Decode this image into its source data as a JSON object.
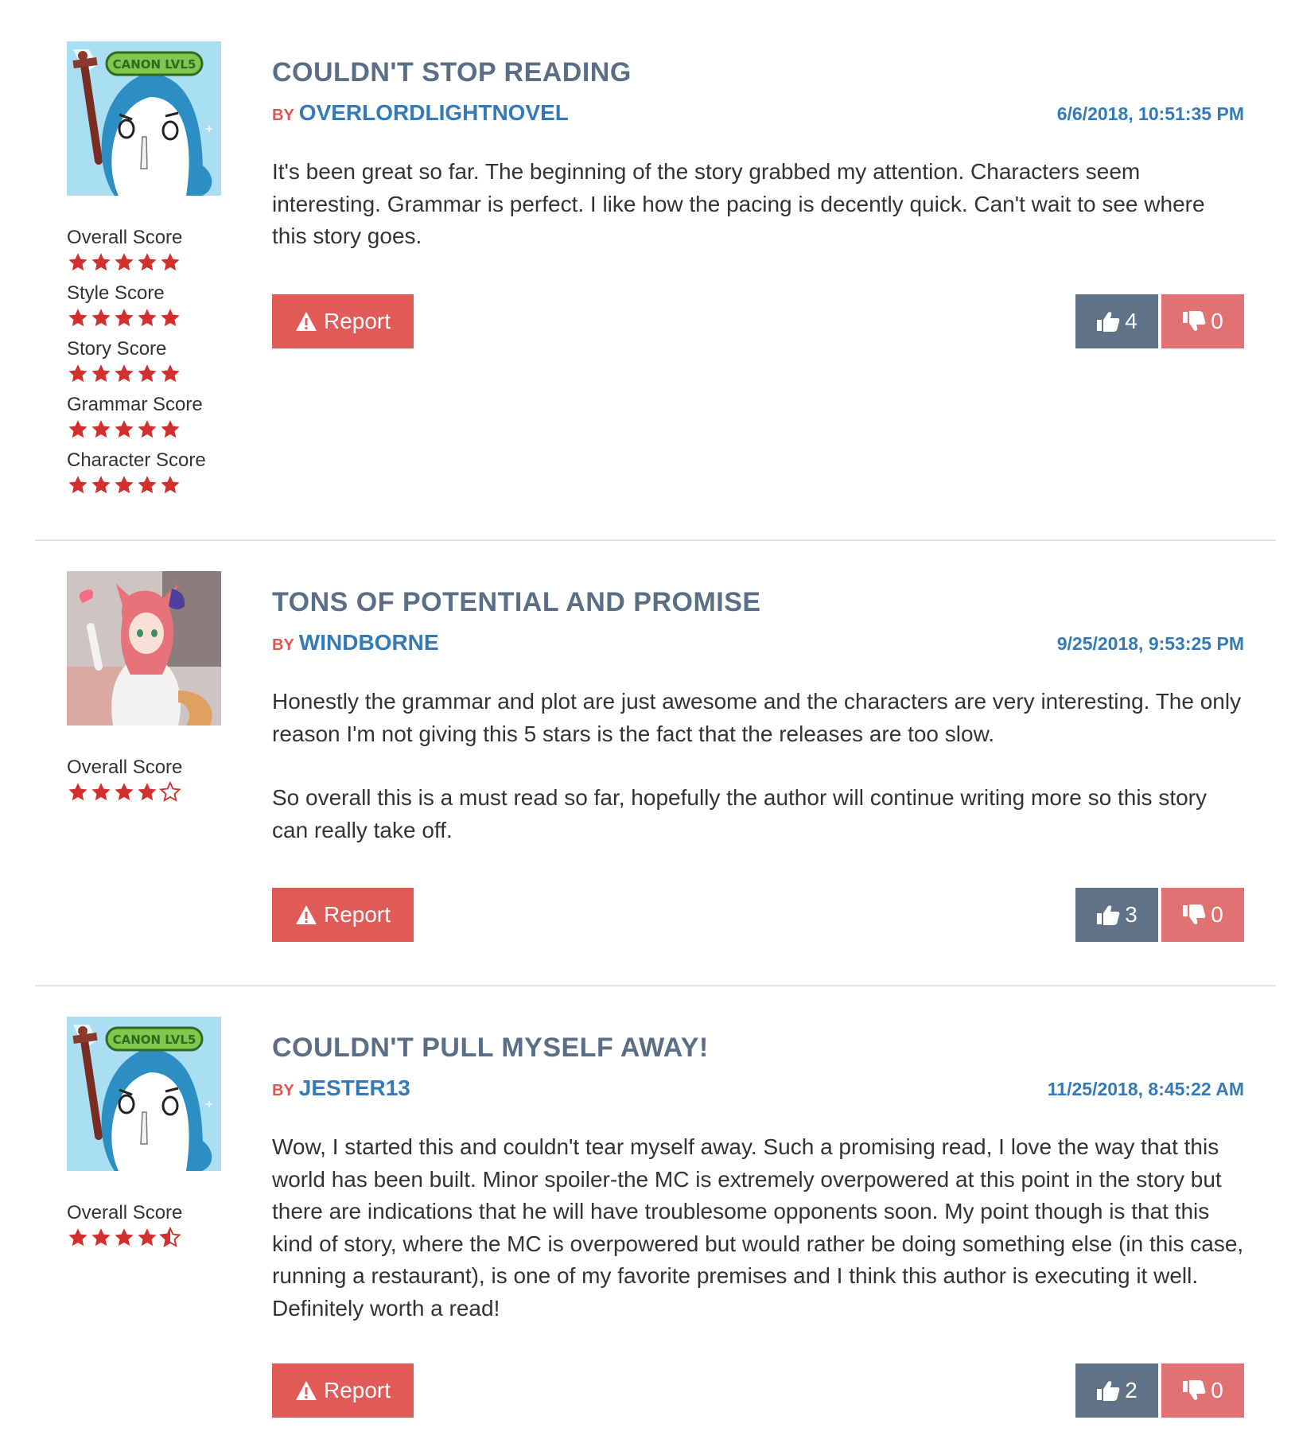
{
  "colors": {
    "title": "#5a6e86",
    "by_label": "#e1534f",
    "author": "#337ab7",
    "date": "#337ab7",
    "star": "#d32f2f",
    "report_bg": "#e05a58",
    "upvote_bg": "#5f7287",
    "downvote_bg": "#e07272"
  },
  "reviews": [
    {
      "title": "COULDN'T STOP READING",
      "by_label": "BY",
      "author": "OVERLORDLIGHTNOVEL",
      "date": "6/6/2018, 10:51:35 PM",
      "avatar": "penguin-avatar",
      "scores": [
        {
          "label": "Overall Score",
          "rating": 5
        },
        {
          "label": "Style Score",
          "rating": 5
        },
        {
          "label": "Story Score",
          "rating": 5
        },
        {
          "label": "Grammar Score",
          "rating": 5
        },
        {
          "label": "Character Score",
          "rating": 5
        }
      ],
      "paragraphs": [
        "It's been great so far. The beginning of the story grabbed my attention. Characters seem interesting. Grammar is perfect. I like how the pacing is decently quick. Can't wait to see where this story goes."
      ],
      "report_label": "Report",
      "upvotes": "4",
      "downvotes": "0"
    },
    {
      "title": "TONS OF POTENTIAL AND PROMISE",
      "by_label": "BY",
      "author": "WINDBORNE",
      "date": "9/25/2018, 9:53:25 PM",
      "avatar": "anime-foxgirl-avatar",
      "scores": [
        {
          "label": "Overall Score",
          "rating": 4
        }
      ],
      "paragraphs": [
        "Honestly the grammar and plot are just awesome and the characters are very interesting. The only reason I'm not giving this 5 stars is the fact that the releases are too slow.",
        "So overall this is a must read so far, hopefully the author will continue writing more so this story can really take off."
      ],
      "report_label": "Report",
      "upvotes": "3",
      "downvotes": "0"
    },
    {
      "title": "COULDN'T PULL MYSELF AWAY!",
      "by_label": "BY",
      "author": "JESTER13",
      "date": "11/25/2018, 8:45:22 AM",
      "avatar": "penguin-avatar",
      "scores": [
        {
          "label": "Overall Score",
          "rating": 4.5
        }
      ],
      "paragraphs": [
        "Wow, I started this and couldn't tear myself away. Such a promising read, I love the way that this world has been built. Minor spoiler-the MC is extremely overpowered at this point in the story but there are indications that he will have troublesome opponents soon. My point though is that this kind of story, where the MC is overpowered but would rather be doing something else (in this case, running a restaurant), is one of my favorite premises and I think this author is executing it well. Definitely worth a read!"
      ],
      "report_label": "Report",
      "upvotes": "2",
      "downvotes": "0"
    }
  ]
}
